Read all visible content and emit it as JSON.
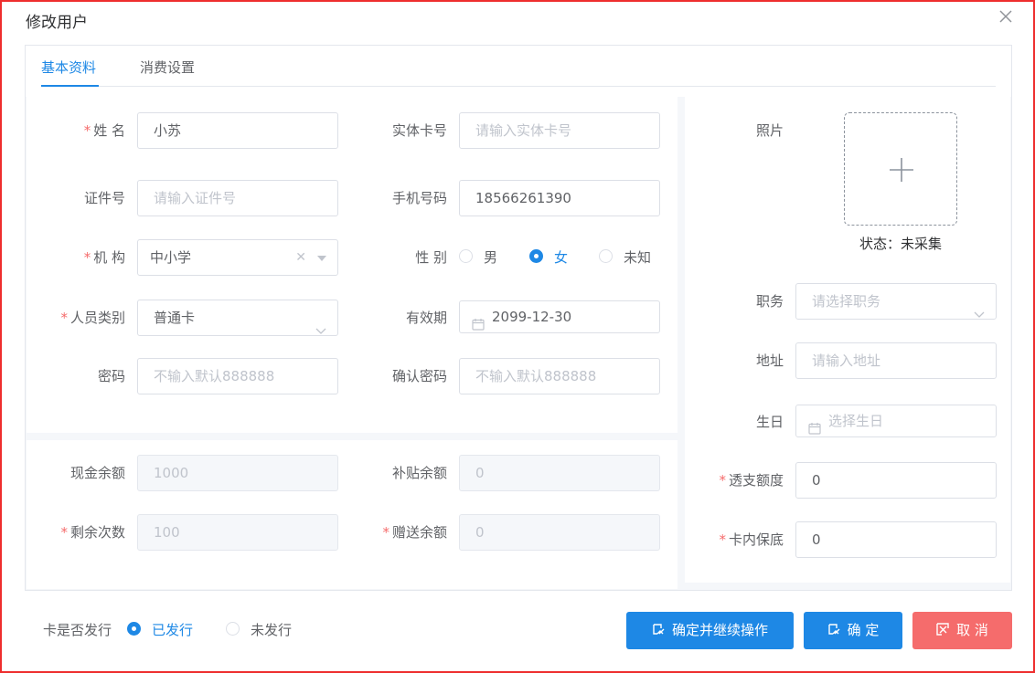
{
  "dialog": {
    "title": "修改用户"
  },
  "tabs": [
    {
      "label": "基本资料",
      "active": true
    },
    {
      "label": "消费设置",
      "active": false
    }
  ],
  "form": {
    "name": {
      "label": "姓 名",
      "required": true,
      "value": "小苏"
    },
    "card_no": {
      "label": "实体卡号",
      "placeholder": "请输入实体卡号"
    },
    "id_no": {
      "label": "证件号",
      "placeholder": "请输入证件号"
    },
    "phone": {
      "label": "手机号码",
      "value": "18566261390"
    },
    "org": {
      "label": "机 构",
      "required": true,
      "value": "中小学"
    },
    "gender": {
      "label": "性 别",
      "options": [
        "男",
        "女",
        "未知"
      ],
      "selected": "女"
    },
    "person_type": {
      "label": "人员类别",
      "required": true,
      "value": "普通卡"
    },
    "valid_until": {
      "label": "有效期",
      "value": "2099-12-30"
    },
    "password": {
      "label": "密码",
      "placeholder": "不输入默认888888"
    },
    "confirm_password": {
      "label": "确认密码",
      "placeholder": "不输入默认888888"
    }
  },
  "balance": {
    "cash": {
      "label": "现金余额",
      "value": "1000"
    },
    "subsidy": {
      "label": "补贴余额",
      "value": "0"
    },
    "remaining_times": {
      "label": "剩余次数",
      "required": true,
      "value": "100"
    },
    "gift": {
      "label": "赠送余额",
      "required": true,
      "value": "0"
    }
  },
  "right": {
    "photo": {
      "label": "照片",
      "status": "状态：未采集"
    },
    "position": {
      "label": "职务",
      "placeholder": "请选择职务"
    },
    "address": {
      "label": "地址",
      "placeholder": "请输入地址"
    },
    "birthday": {
      "label": "生日",
      "placeholder": "选择生日"
    },
    "overdraft": {
      "label": "透支额度",
      "required": true,
      "value": "0"
    },
    "min_balance": {
      "label": "卡内保底",
      "required": true,
      "value": "0"
    }
  },
  "footer": {
    "issued_label": "卡是否发行",
    "issued_options": [
      "已发行",
      "未发行"
    ],
    "issued_selected": "已发行",
    "btn_confirm_continue": "确定并继续操作",
    "btn_confirm": "确 定",
    "btn_cancel": "取 消"
  },
  "colors": {
    "primary": "#1e88e5",
    "danger": "#f56c6c",
    "required": "#f56c6c"
  },
  "icons": {
    "close": "close-icon",
    "plus": "plus-icon",
    "calendar": "calendar-icon",
    "edit": "edit-icon",
    "cancel": "cancel-icon"
  }
}
